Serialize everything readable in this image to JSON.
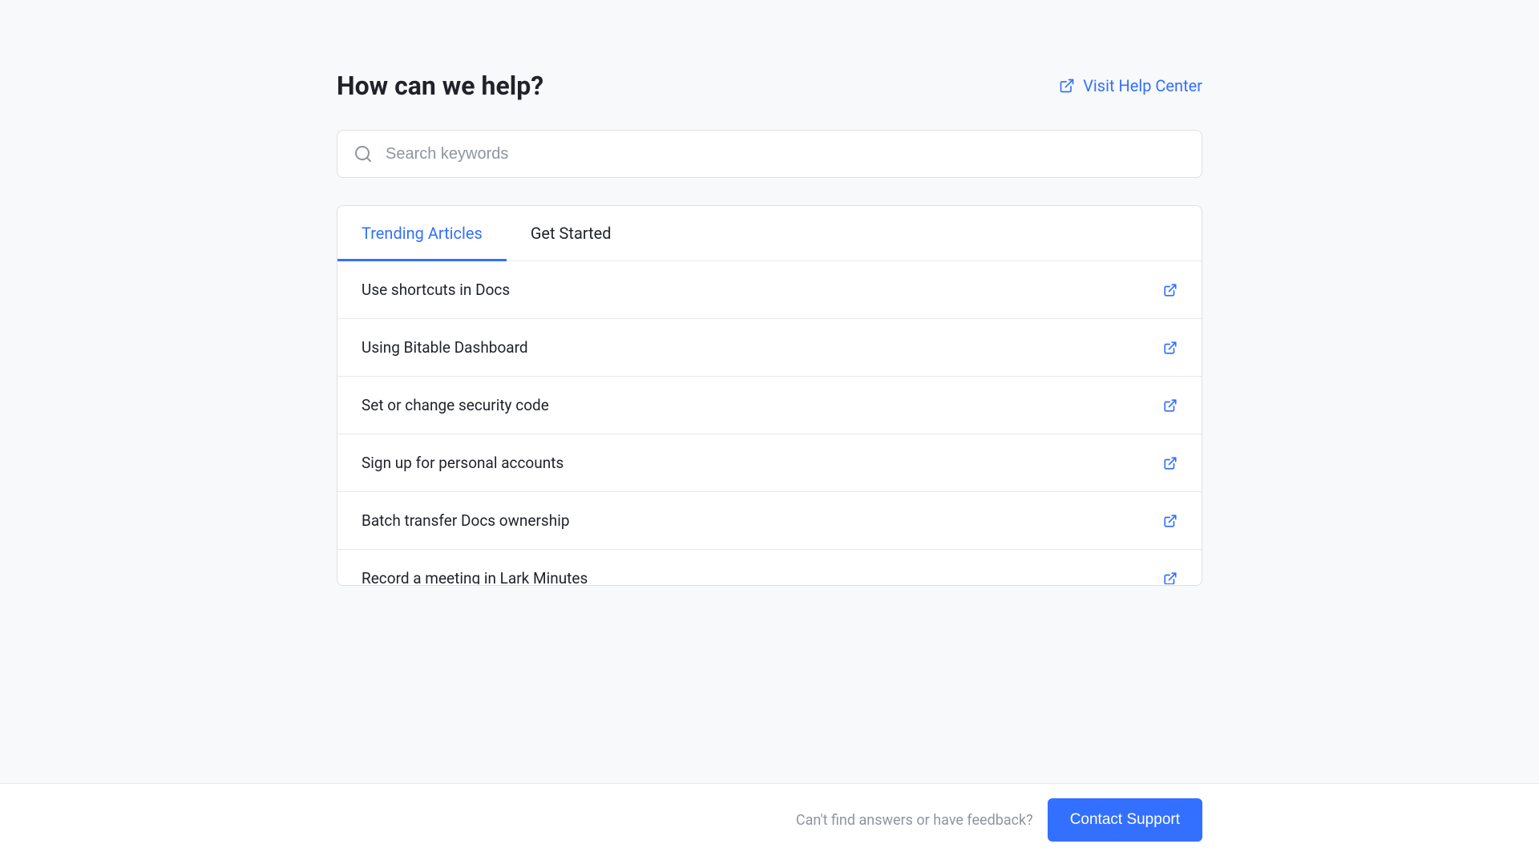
{
  "header": {
    "title": "How can we help?",
    "help_center_label": "Visit Help Center"
  },
  "search": {
    "placeholder": "Search keywords"
  },
  "tabs": [
    {
      "label": "Trending Articles",
      "active": true
    },
    {
      "label": "Get Started",
      "active": false
    }
  ],
  "articles": [
    {
      "title": "Use shortcuts in Docs"
    },
    {
      "title": "Using Bitable Dashboard"
    },
    {
      "title": "Set or change security code"
    },
    {
      "title": "Sign up for personal accounts"
    },
    {
      "title": "Batch transfer Docs ownership"
    },
    {
      "title": "Record a meeting in Lark Minutes"
    }
  ],
  "footer": {
    "prompt": "Can't find answers or have feedback?",
    "button_label": "Contact Support"
  }
}
